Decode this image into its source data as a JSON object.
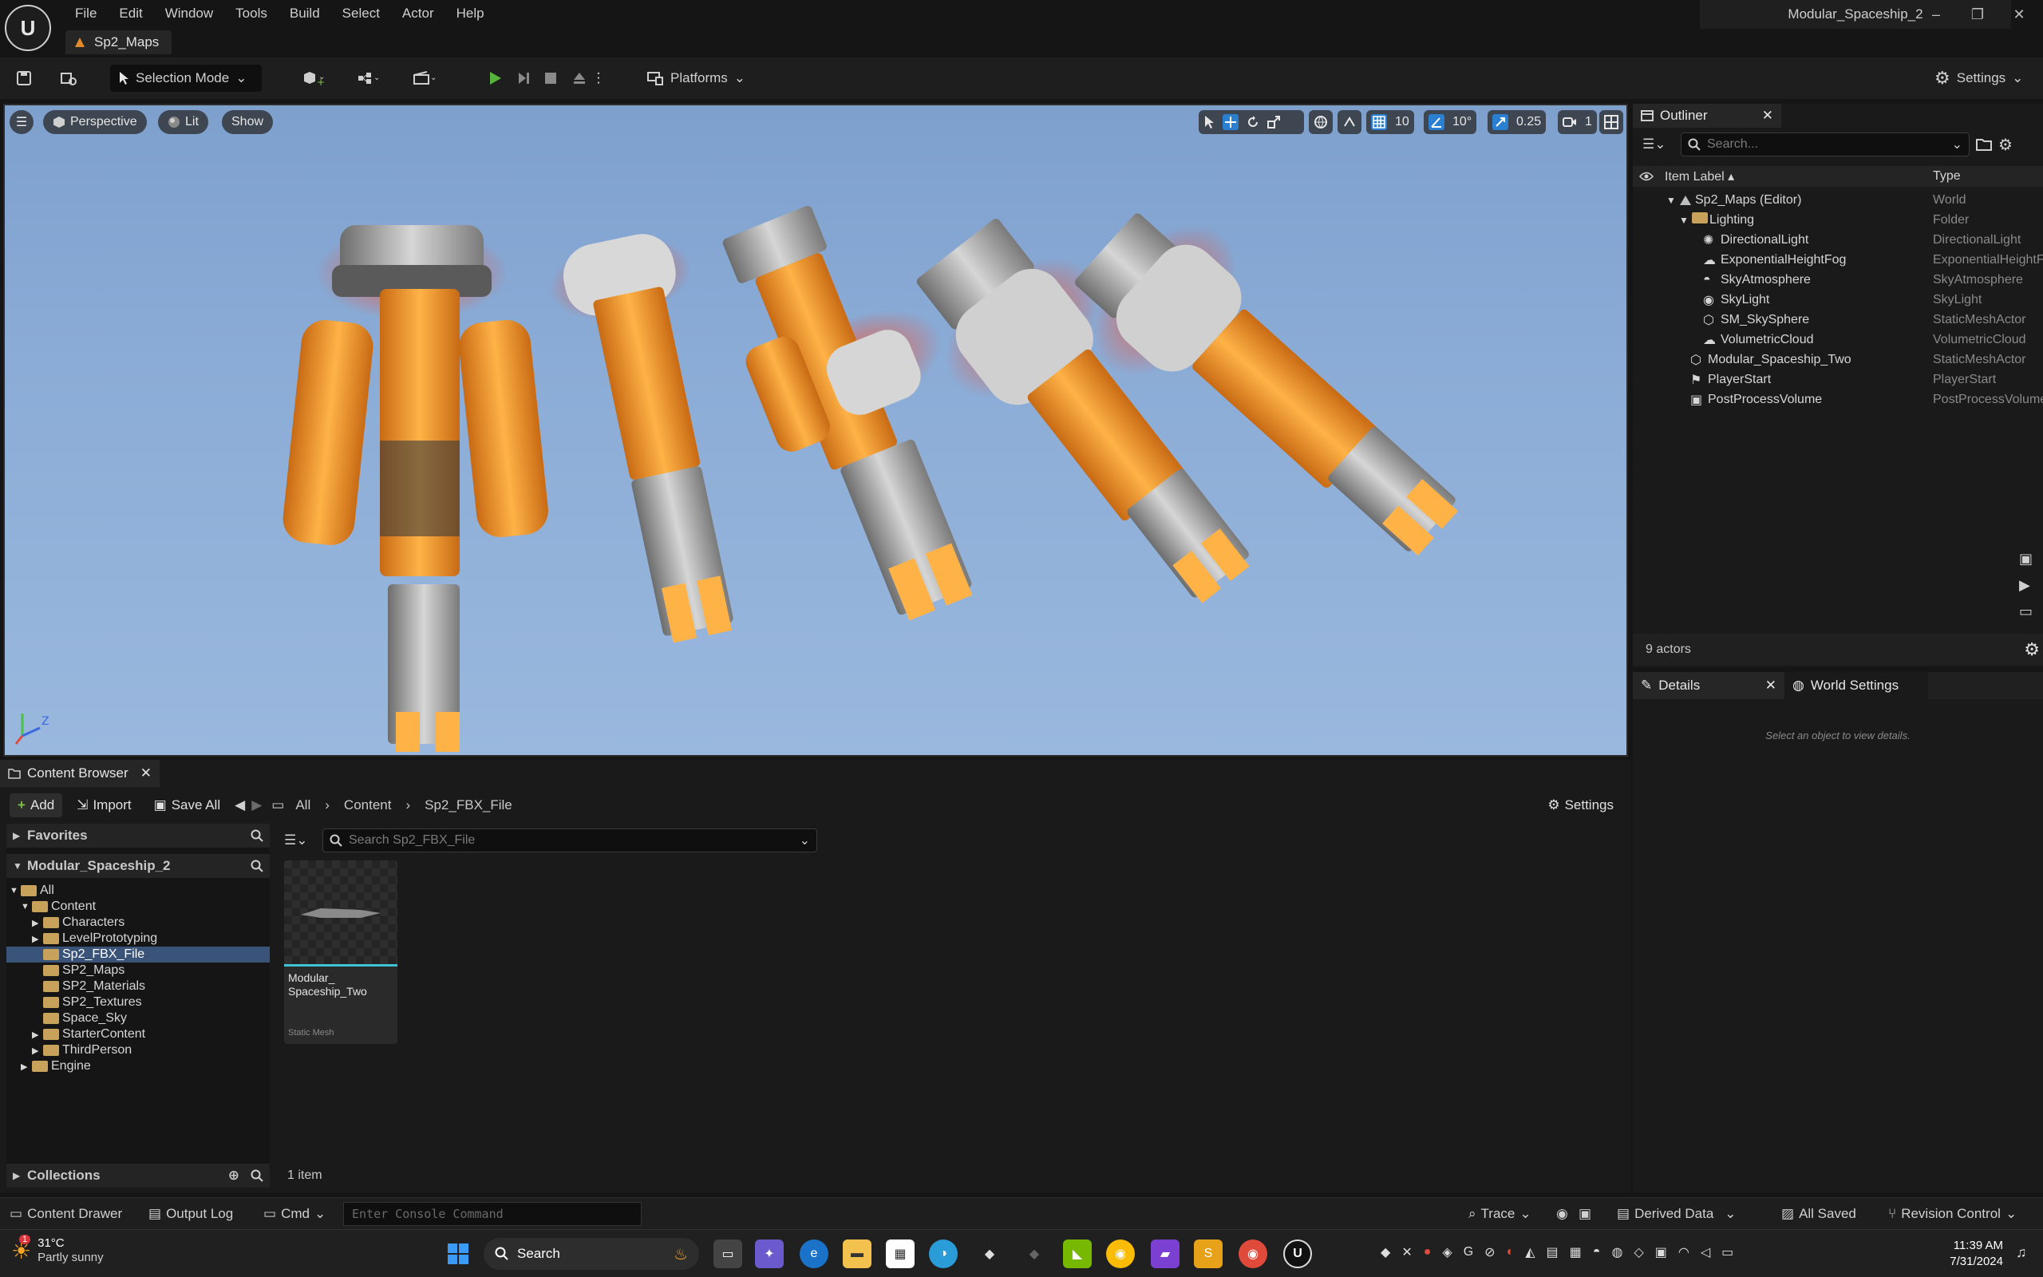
{
  "app": {
    "logo_text": "U",
    "menu": [
      "File",
      "Edit",
      "Window",
      "Tools",
      "Build",
      "Select",
      "Actor",
      "Help"
    ],
    "level_tab": "Sp2_Maps",
    "project_title": "Modular_Spaceship_2",
    "window_controls": [
      "–",
      "❐",
      "✕"
    ]
  },
  "toolbar": {
    "selection_mode": "Selection Mode",
    "platforms": "Platforms",
    "settings": "Settings"
  },
  "viewport": {
    "perspective": "Perspective",
    "lit": "Lit",
    "show": "Show",
    "grid_snap": "10",
    "rotation_snap": "10°",
    "scale_snap": "0.25",
    "camera_speed": "1"
  },
  "outliner": {
    "tab": "Outliner",
    "search_placeholder": "Search...",
    "col_label": "Item Label ▴",
    "col_type": "Type",
    "rows": [
      {
        "label": "Sp2_Maps (Editor)",
        "type": "World",
        "icon": "world-icon"
      },
      {
        "label": "Lighting",
        "type": "Folder",
        "icon": "folder-icon"
      },
      {
        "label": "DirectionalLight",
        "type": "DirectionalLight",
        "icon": "sun-icon"
      },
      {
        "label": "ExponentialHeightFog",
        "type": "ExponentialHeightFog",
        "icon": "fog-icon"
      },
      {
        "label": "SkyAtmosphere",
        "type": "SkyAtmosphere",
        "icon": "atmosphere-icon"
      },
      {
        "label": "SkyLight",
        "type": "SkyLight",
        "icon": "skylight-icon"
      },
      {
        "label": "SM_SkySphere",
        "type": "StaticMeshActor",
        "icon": "mesh-icon"
      },
      {
        "label": "VolumetricCloud",
        "type": "VolumetricCloud",
        "icon": "cloud-icon"
      },
      {
        "label": "Modular_Spaceship_Two",
        "type": "StaticMeshActor",
        "icon": "mesh-icon"
      },
      {
        "label": "PlayerStart",
        "type": "PlayerStart",
        "icon": "player-start-icon"
      },
      {
        "label": "PostProcessVolume",
        "type": "PostProcessVolume",
        "icon": "volume-icon"
      }
    ],
    "actor_count": "9 actors"
  },
  "details": {
    "tab": "Details",
    "world_settings_tab": "World Settings",
    "empty_message": "Select an object to view details."
  },
  "content_browser": {
    "tab": "Content Browser",
    "add": "Add",
    "import": "Import",
    "save_all": "Save All",
    "breadcrumb": [
      "All",
      "Content",
      "Sp2_FBX_File"
    ],
    "settings": "Settings",
    "favorites": "Favorites",
    "project": "Modular_Spaceship_2",
    "search_placeholder": "Search Sp2_FBX_File",
    "tree": [
      {
        "label": "All",
        "depth": 0,
        "expanded": true
      },
      {
        "label": "Content",
        "depth": 1,
        "expanded": true
      },
      {
        "label": "Characters",
        "depth": 2,
        "arrow": true
      },
      {
        "label": "LevelPrototyping",
        "depth": 2,
        "arrow": true
      },
      {
        "label": "Sp2_FBX_File",
        "depth": 2,
        "selected": true
      },
      {
        "label": "SP2_Maps",
        "depth": 2
      },
      {
        "label": "SP2_Materials",
        "depth": 2
      },
      {
        "label": "SP2_Textures",
        "depth": 2
      },
      {
        "label": "Space_Sky",
        "depth": 2
      },
      {
        "label": "StarterContent",
        "depth": 2,
        "arrow": true
      },
      {
        "label": "ThirdPerson",
        "depth": 2,
        "arrow": true
      },
      {
        "label": "Engine",
        "depth": 1,
        "arrow": true
      }
    ],
    "asset_name_line1": "Modular_",
    "asset_name_line2": "Spaceship_Two",
    "asset_type": "Static Mesh",
    "collections": "Collections",
    "item_count": "1 item"
  },
  "statusbar": {
    "content_drawer": "Content Drawer",
    "output_log": "Output Log",
    "cmd": "Cmd",
    "console_placeholder": "Enter Console Command",
    "trace": "Trace",
    "derived_data": "Derived Data",
    "all_saved": "All Saved",
    "revision_control": "Revision Control"
  },
  "taskbar": {
    "weather_temp": "31°C",
    "weather_desc": "Partly sunny",
    "weather_badge": "1",
    "search": "Search",
    "time": "11:39 AM",
    "date": "7/31/2024"
  }
}
